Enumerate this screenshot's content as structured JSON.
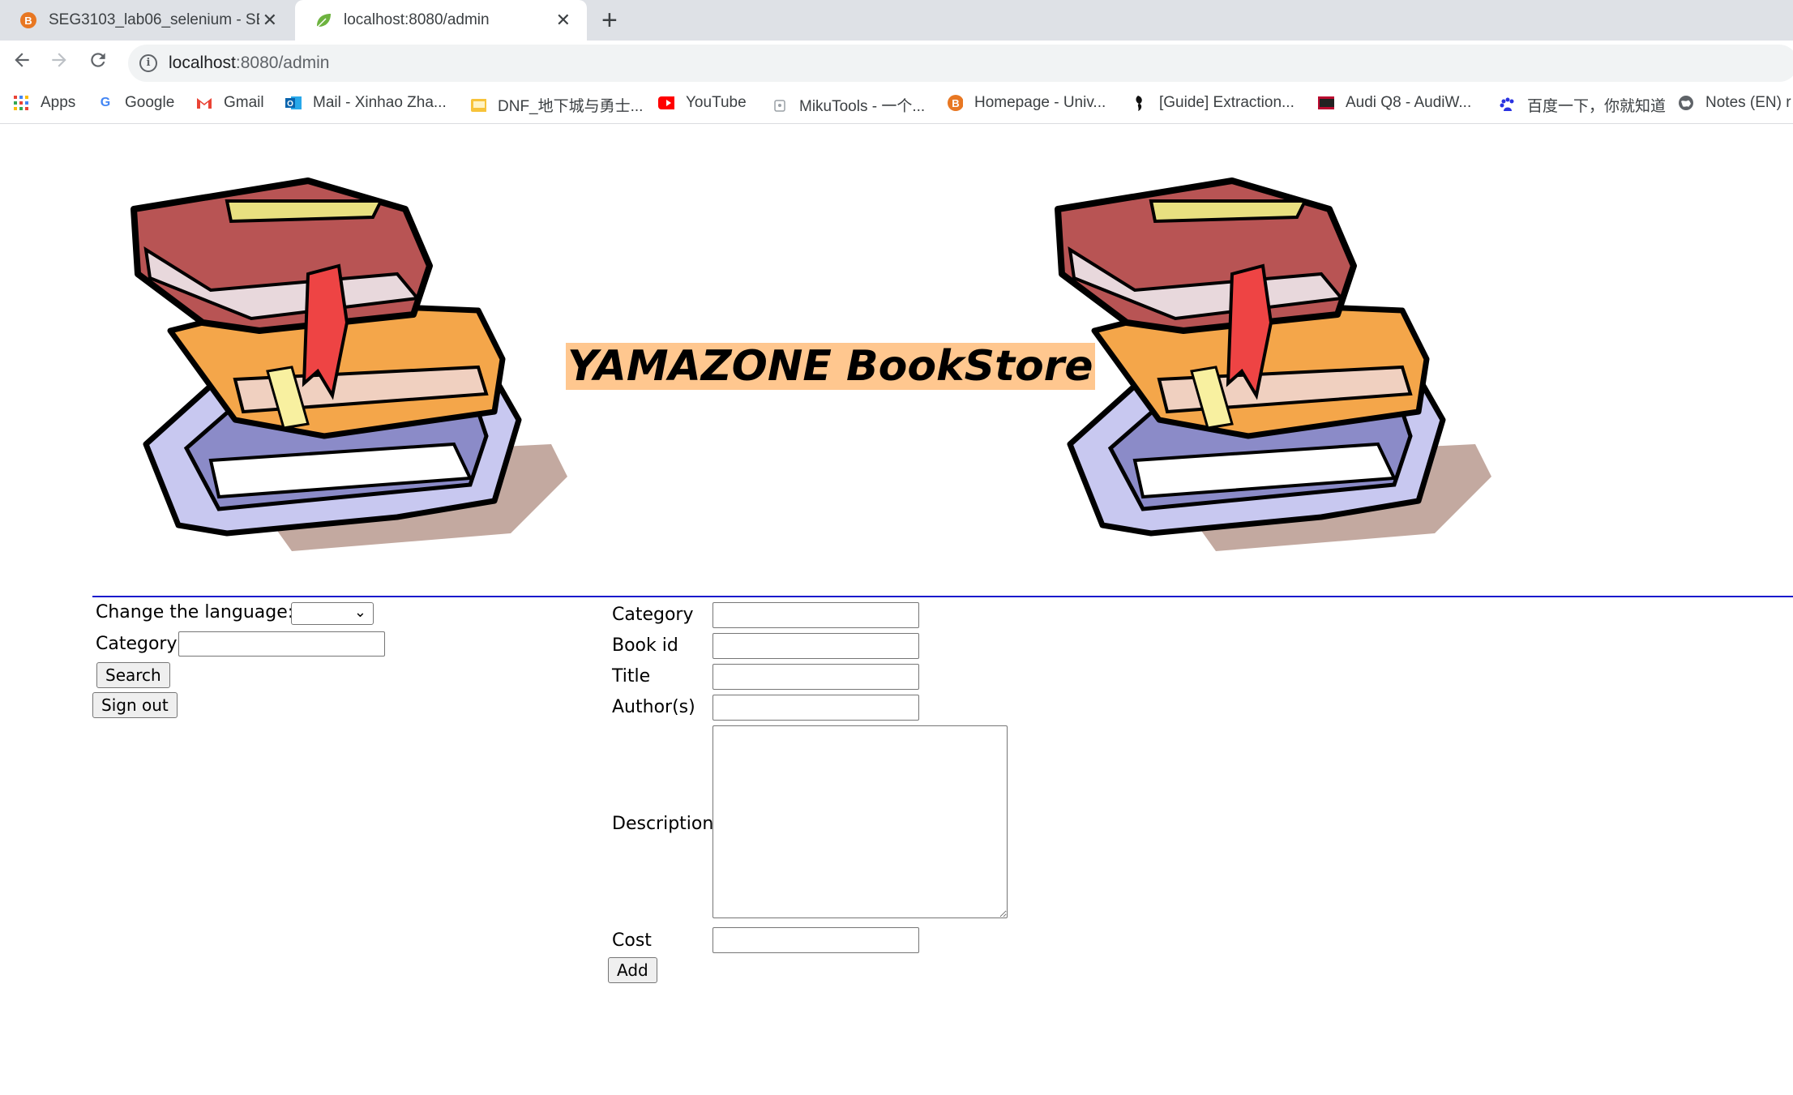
{
  "browser": {
    "tabs": [
      {
        "title": "SEG3103_lab06_selenium - SEG3103",
        "active": false
      },
      {
        "title": "localhost:8080/admin",
        "active": true
      }
    ],
    "new_tab": "+",
    "url_host": "localhost",
    "url_rest": ":8080/admin",
    "bookmarks": [
      {
        "label": "Apps",
        "icon": "apps-grid-icon"
      },
      {
        "label": "Google",
        "icon": "google-icon"
      },
      {
        "label": "Gmail",
        "icon": "gmail-icon"
      },
      {
        "label": "Mail - Xinhao Zha...",
        "icon": "outlook-icon"
      },
      {
        "label": "DNF_地下城与勇士...",
        "icon": "dnf-icon"
      },
      {
        "label": "YouTube",
        "icon": "youtube-icon"
      },
      {
        "label": "MikuTools - 一个...",
        "icon": "mikutools-icon"
      },
      {
        "label": "Homepage - Univ...",
        "icon": "brightspace-icon"
      },
      {
        "label": "[Guide] Extraction...",
        "icon": "guide-icon"
      },
      {
        "label": "Audi Q8 - AudiW...",
        "icon": "audi-icon"
      },
      {
        "label": "百度一下，你就知道",
        "icon": "baidu-icon"
      },
      {
        "label": "Notes (EN) r",
        "icon": "notes-icon"
      }
    ]
  },
  "page": {
    "site_title": "YAMAZONE BookStore",
    "left_form": {
      "language_label": "Change the language:",
      "language_selected": "",
      "category_label": "Category",
      "category_value": "",
      "search_button": "Search",
      "signout_button": "Sign out"
    },
    "add_form": {
      "category_label": "Category",
      "bookid_label": "Book id",
      "title_label": "Title",
      "authors_label": "Author(s)",
      "description_label": "Description",
      "cost_label": "Cost",
      "add_button": "Add"
    }
  }
}
